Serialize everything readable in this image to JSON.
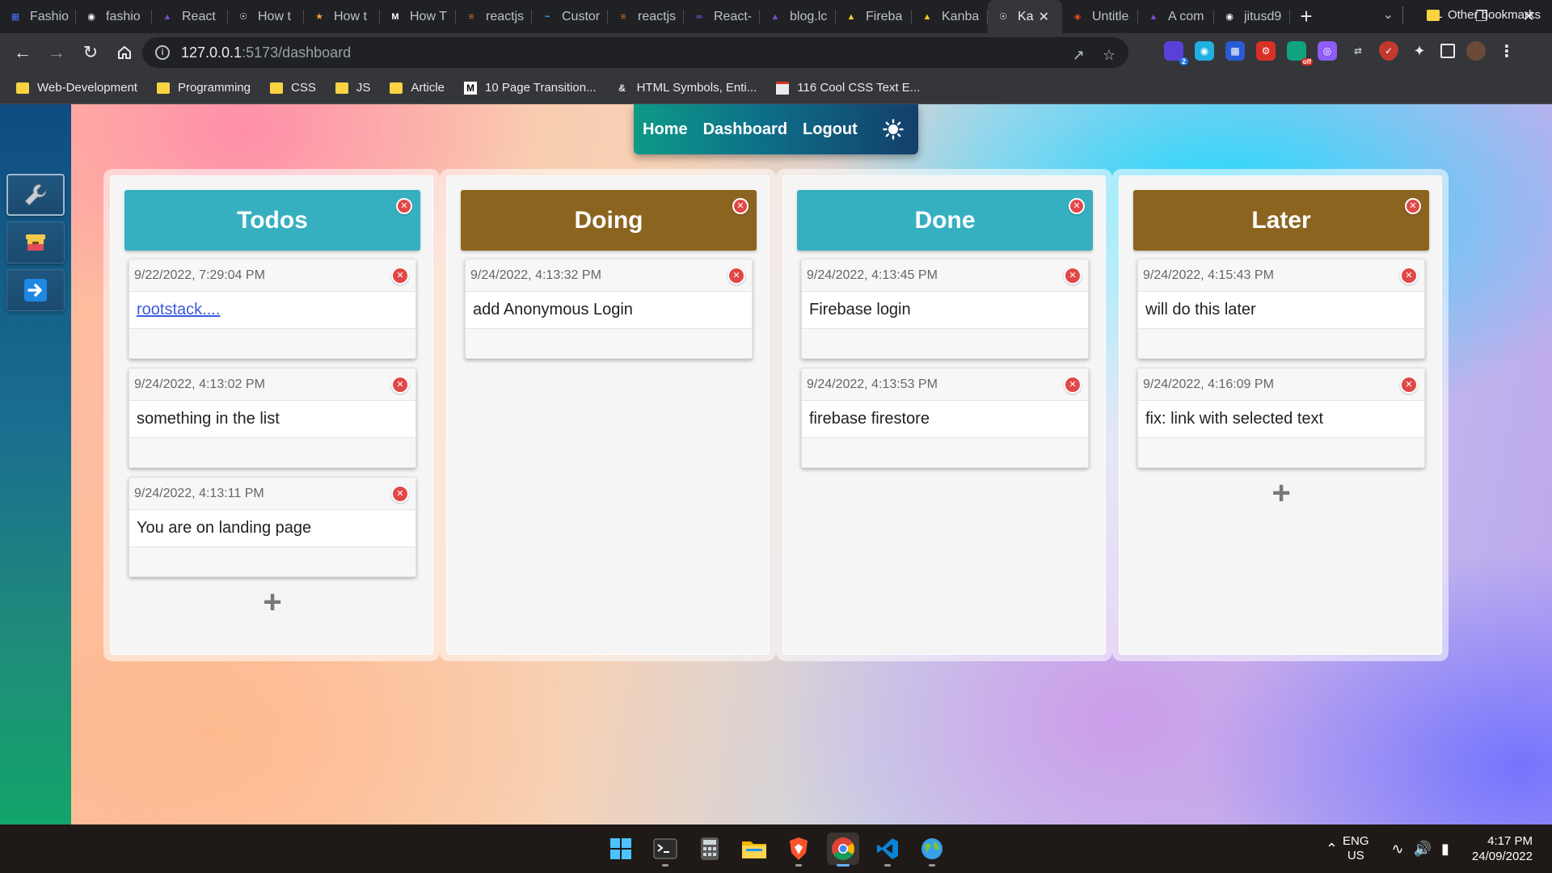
{
  "browser": {
    "tabs": [
      {
        "title": "Fashio",
        "favicon": "calendar-icon",
        "color": "#4a6cf7"
      },
      {
        "title": "fashio",
        "favicon": "github-icon",
        "color": "#ffffff"
      },
      {
        "title": "React",
        "favicon": "rocket-icon",
        "color": "#7b4ad9"
      },
      {
        "title": "How t",
        "favicon": "globe-icon",
        "color": "#ffffff"
      },
      {
        "title": "How t",
        "favicon": "trophy-icon",
        "color": "#f0a030"
      },
      {
        "title": "How T",
        "favicon": "medium-icon",
        "color": "#ffffff"
      },
      {
        "title": "reactjs",
        "favicon": "stackoverflow-icon",
        "color": "#f48024"
      },
      {
        "title": "Custor",
        "favicon": "tailwind-icon",
        "color": "#38bdf8"
      },
      {
        "title": "reactjs",
        "favicon": "stackoverflow-icon",
        "color": "#f48024"
      },
      {
        "title": "React-",
        "favicon": "infinity-icon",
        "color": "#7b4ad9"
      },
      {
        "title": "blog.lc",
        "favicon": "rocket-icon",
        "color": "#7b4ad9"
      },
      {
        "title": "Fireba",
        "favicon": "firebase-icon",
        "color": "#ffca28"
      },
      {
        "title": "Kanba",
        "favicon": "firebase-icon",
        "color": "#ffca28"
      },
      {
        "title": "Ka",
        "favicon": "globe-icon",
        "color": "#ffffff",
        "active": true
      },
      {
        "title": "Untitle",
        "favicon": "figma-icon",
        "color": "#f24e1e"
      },
      {
        "title": "A com",
        "favicon": "rocket-icon",
        "color": "#7b4ad9"
      },
      {
        "title": "jitusd9",
        "favicon": "github-icon",
        "color": "#ffffff"
      }
    ],
    "new_tab_label": "+",
    "address_host": "127.0.0.1",
    "address_path": ":5173/dashboard",
    "bookmarks": [
      {
        "label": "Web-Development",
        "type": "folder"
      },
      {
        "label": "Programming",
        "type": "folder"
      },
      {
        "label": "CSS",
        "type": "folder"
      },
      {
        "label": "JS",
        "type": "folder"
      },
      {
        "label": "Article",
        "type": "folder"
      },
      {
        "label": "10 Page Transition...",
        "type": "medium"
      },
      {
        "label": "HTML Symbols, Enti...",
        "type": "entity"
      },
      {
        "label": "116 Cool CSS Text E...",
        "type": "page"
      }
    ],
    "other_bookmarks": "Other bookmarks",
    "extension_badge": "2",
    "extension_off": "off"
  },
  "app": {
    "nav": {
      "home": "Home",
      "dashboard": "Dashboard",
      "logout": "Logout"
    },
    "columns": [
      {
        "title": "Todos",
        "color": "#36b0c1",
        "cards": [
          {
            "date": "9/22/2022, 7:29:04 PM",
            "text": "rootstack....",
            "link": true
          },
          {
            "date": "9/24/2022, 4:13:02 PM",
            "text": "something in the list"
          },
          {
            "date": "9/24/2022, 4:13:11 PM",
            "text": "You are on landing page"
          }
        ],
        "show_add": true
      },
      {
        "title": "Doing",
        "color": "#8b6520",
        "cards": [
          {
            "date": "9/24/2022, 4:13:32 PM",
            "text": "add Anonymous Login"
          }
        ],
        "show_add": false
      },
      {
        "title": "Done",
        "color": "#36b0c1",
        "cards": [
          {
            "date": "9/24/2022, 4:13:45 PM",
            "text": "Firebase login"
          },
          {
            "date": "9/24/2022, 4:13:53 PM",
            "text": "firebase firestore"
          }
        ],
        "show_add": false
      },
      {
        "title": "Later",
        "color": "#8b6520",
        "cards": [
          {
            "date": "9/24/2022, 4:15:43 PM",
            "text": "will do this later"
          },
          {
            "date": "9/24/2022, 4:16:09 PM",
            "text": "fix: link with selected text"
          }
        ],
        "show_add": true
      }
    ]
  },
  "taskbar": {
    "apps": [
      "windows-start-icon",
      "terminal-icon",
      "calculator-icon",
      "file-explorer-icon",
      "brave-icon",
      "chrome-icon",
      "vscode-icon",
      "globe-app-icon"
    ],
    "lang_line1": "ENG",
    "lang_line2": "US",
    "time": "4:17 PM",
    "date": "24/09/2022"
  }
}
